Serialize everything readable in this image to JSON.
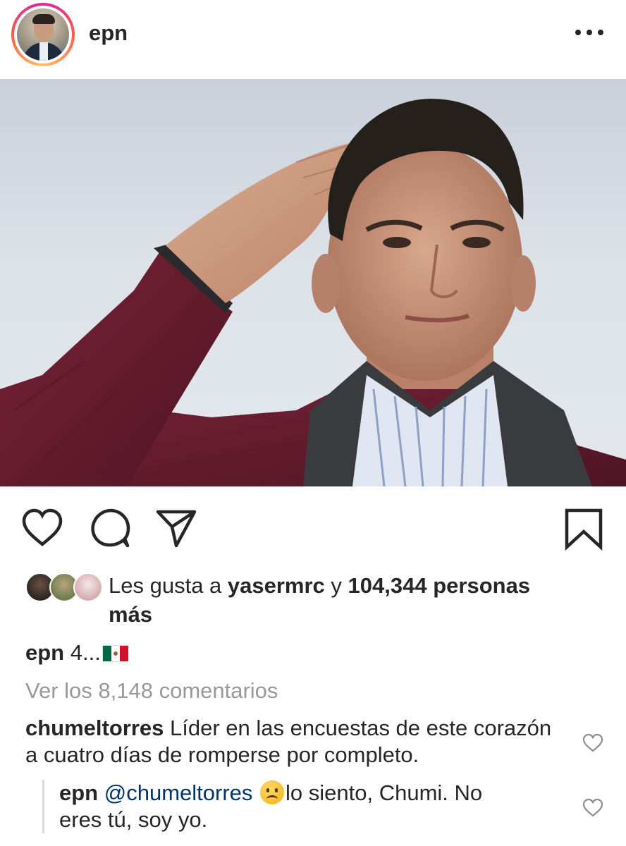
{
  "header": {
    "username": "epn",
    "more_icon": "more-options-icon"
  },
  "photo": {
    "description_icon": "post-photo"
  },
  "actions": {
    "like_icon": "heart-icon",
    "comment_icon": "comment-icon",
    "share_icon": "send-icon",
    "save_icon": "bookmark-icon"
  },
  "likes": {
    "prefix": "Les gusta a ",
    "user": "yasermrc",
    "connector": " y ",
    "count": "104,344 personas",
    "suffix": "más"
  },
  "caption": {
    "username": "epn",
    "text": " 4...",
    "emoji": "mexico-flag"
  },
  "view_comments": "Ver los 8,148 comentarios",
  "comments": [
    {
      "username": "chumeltorres",
      "text": " Líder en las encuestas de este corazón a cuatro días de romperse por completo."
    }
  ],
  "reply": {
    "username": "epn",
    "mention": "@chumeltorres",
    "emoji": "frowning-face",
    "text_line1": "lo siento, Chumi. No",
    "text_line2": "eres tú, soy yo."
  },
  "colors": {
    "text": "#262626",
    "muted": "#999999",
    "mention": "#003569",
    "story_ring": [
      "#d6249f",
      "#fd5949",
      "#fdc468"
    ]
  }
}
